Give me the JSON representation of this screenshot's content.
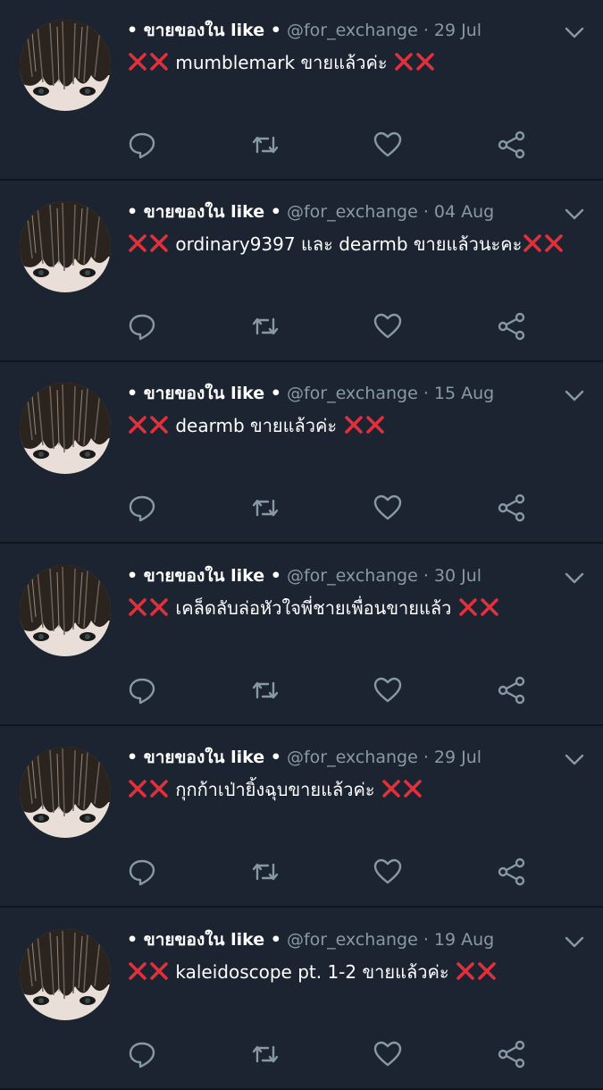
{
  "account": {
    "name": "• ขายของใน like •",
    "handle": "@for_exchange"
  },
  "icons": [
    "chevron-down-icon",
    "reply-icon",
    "retweet-icon",
    "like-icon",
    "share-icon",
    "red-x-icon"
  ],
  "colors": {
    "background": "#1b2430",
    "muted": "#8899a6",
    "red_x": "#e0303c",
    "divider": "#0f151c"
  },
  "tweets": [
    {
      "date": "· 29 Jul",
      "text": " mumblemark ขายแล้วค่ะ "
    },
    {
      "date": "· 04 Aug",
      "text": " ordinary9397 และ dearmb ขายแล้วนะคะ"
    },
    {
      "date": "· 15 Aug",
      "text": " dearmb ขายแล้วค่ะ "
    },
    {
      "date": "· 30 Jul",
      "text": " เคล็ดลับล่อหัวใจพี่ชายเพื่อนขายแล้ว "
    },
    {
      "date": "· 29 Jul",
      "text": " กุกก้าเป่ายิ้งฉุบขายแล้วค่ะ "
    },
    {
      "date": "· 19 Aug",
      "text": " kaleidoscope pt. 1-2 ขายแล้วค่ะ "
    }
  ]
}
